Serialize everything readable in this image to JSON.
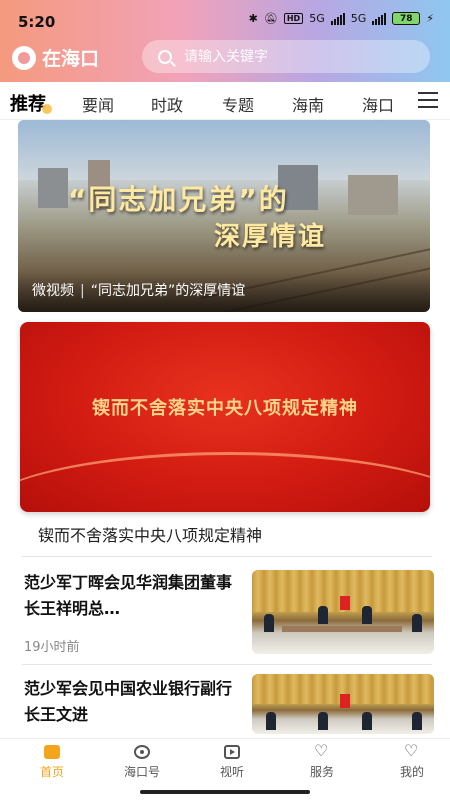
{
  "status_bar": {
    "time": "5:20",
    "hd_label": "HD",
    "network_1": "5G",
    "network_2": "5G",
    "battery": "78"
  },
  "header": {
    "brand": "在海口",
    "search_placeholder": "请输入关键字",
    "gradient_colors": [
      "#f49a7e",
      "#f2a2b8",
      "#b8a6e2",
      "#8fc7f0"
    ]
  },
  "tabs": [
    {
      "label": "推荐",
      "active": true
    },
    {
      "label": "要闻",
      "active": false
    },
    {
      "label": "时政",
      "active": false
    },
    {
      "label": "专题",
      "active": false
    },
    {
      "label": "海南",
      "active": false
    },
    {
      "label": "海口",
      "active": false
    }
  ],
  "feed": {
    "video_card": {
      "overlay_title_line1": "“同志加兄弟”的",
      "overlay_title_line2": "深厚情谊",
      "category": "微视频",
      "caption": "“同志加兄弟”的深厚情谊"
    },
    "banner_card": {
      "banner_text": "锲而不舍落实中央八项规定精神",
      "caption": "锲而不舍落实中央八项规定精神",
      "color": "#d11b12"
    },
    "news": [
      {
        "title": "范少军丁晖会见华润集团董事长王祥明总…",
        "time": "19小时前"
      },
      {
        "title": "范少军会见中国农业银行副行长王文进",
        "time": ""
      }
    ]
  },
  "bottom_nav": [
    {
      "label": "首页",
      "icon": "home-icon",
      "active": true
    },
    {
      "label": "海口号",
      "icon": "eye-icon",
      "active": false
    },
    {
      "label": "视听",
      "icon": "play-icon",
      "active": false
    },
    {
      "label": "服务",
      "icon": "heart-icon",
      "active": false
    },
    {
      "label": "我的",
      "icon": "heart-icon",
      "active": false
    }
  ],
  "accent_color": "#f3a51b"
}
